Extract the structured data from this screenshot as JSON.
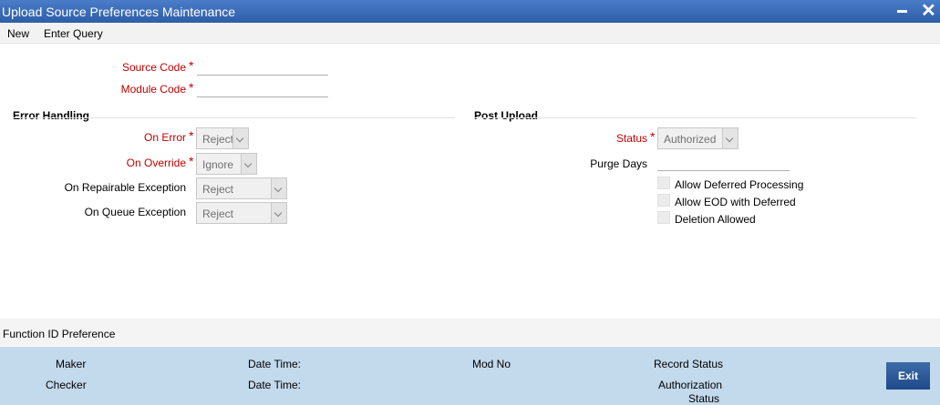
{
  "window": {
    "title": "Upload Source Preferences Maintenance"
  },
  "menu": {
    "items": [
      "New",
      "Enter Query"
    ]
  },
  "header_fields": {
    "source_code": {
      "label": "Source Code",
      "value": ""
    },
    "module_code": {
      "label": "Module Code",
      "value": ""
    }
  },
  "error_handling": {
    "title": "Error Handling",
    "on_error": {
      "label": "On Error",
      "value": "Reject"
    },
    "on_override": {
      "label": "On Override",
      "value": "Ignore"
    },
    "on_repairable_exception": {
      "label": "On Repairable Exception",
      "value": "Reject"
    },
    "on_queue_exception": {
      "label": "On Queue Exception",
      "value": "Reject"
    }
  },
  "post_upload": {
    "title": "Post Upload",
    "status": {
      "label": "Status",
      "value": "Authorized"
    },
    "purge_days": {
      "label": "Purge Days",
      "value": ""
    },
    "checkboxes": [
      {
        "label": "Allow Deferred Processing",
        "checked": false
      },
      {
        "label": "Allow EOD with Deferred",
        "checked": false
      },
      {
        "label": "Deletion Allowed",
        "checked": false
      }
    ]
  },
  "function_id_preference": {
    "label": "Function ID Preference"
  },
  "footer": {
    "maker": "Maker",
    "checker": "Checker",
    "date_time_1": "Date Time:",
    "date_time_2": "Date Time:",
    "mod_no": "Mod No",
    "record_status": "Record Status",
    "authorization_status_line1": "Authorization",
    "authorization_status_line2": "Status",
    "exit_label": "Exit"
  }
}
